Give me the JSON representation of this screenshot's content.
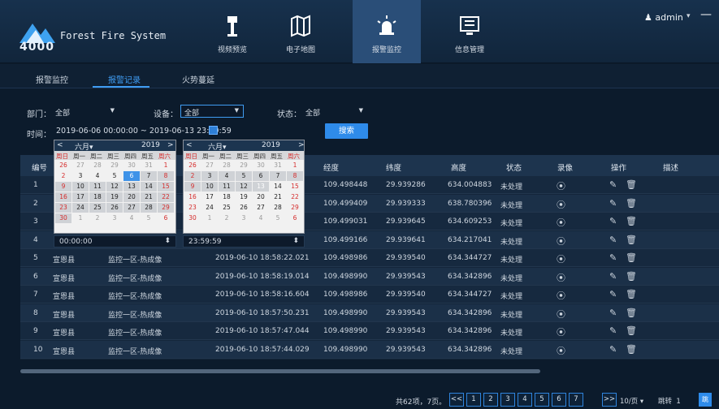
{
  "app": {
    "logo_number": "4000",
    "title": "Forest Fire System"
  },
  "nav": [
    {
      "label": "视频预览",
      "icon": "camera-tower-icon"
    },
    {
      "label": "电子地图",
      "icon": "map-icon"
    },
    {
      "label": "报警监控",
      "icon": "alarm-icon"
    },
    {
      "label": "信息管理",
      "icon": "monitor-info-icon"
    }
  ],
  "user": {
    "name": "admin",
    "dropdown": "▾",
    "minimize": "—",
    "close": "×"
  },
  "tabs": [
    "报警监控",
    "报警记录",
    "火势蔓延"
  ],
  "filters": {
    "dept_label": "部门：",
    "dept_value": "全部",
    "device_label": "设备：",
    "device_value": "全部",
    "status_label": "状态：",
    "status_value": "全部",
    "time_label": "时间：",
    "time_value": "2019-06-06 00:00:00 ~ 2019-06-13 23:59:59",
    "search_label": "搜索"
  },
  "calendar": {
    "left": {
      "prev": "<",
      "month": "六月▾",
      "year": "2019",
      "next": ">",
      "time": "00:00:00",
      "spin": "⬍"
    },
    "right": {
      "prev": "<",
      "month": "六月▾",
      "year": "2019",
      "next": ">",
      "time": "23:59:59",
      "spin": "⬍"
    },
    "weekdays": [
      "周日",
      "周一",
      "周二",
      "周三",
      "周四",
      "周五",
      "周六"
    ],
    "left_days": [
      [
        "26",
        "27",
        "28",
        "29",
        "30",
        "31",
        "1"
      ],
      [
        "2",
        "3",
        "4",
        "5",
        "6",
        "7",
        "8"
      ],
      [
        "9",
        "10",
        "11",
        "12",
        "13",
        "14",
        "15"
      ],
      [
        "16",
        "17",
        "18",
        "19",
        "20",
        "21",
        "22"
      ],
      [
        "23",
        "24",
        "25",
        "26",
        "27",
        "28",
        "29"
      ],
      [
        "30",
        "1",
        "2",
        "3",
        "4",
        "5",
        "6"
      ]
    ],
    "right_days": [
      [
        "26",
        "27",
        "28",
        "29",
        "30",
        "31",
        "1"
      ],
      [
        "2",
        "3",
        "4",
        "5",
        "6",
        "7",
        "8"
      ],
      [
        "9",
        "10",
        "11",
        "12",
        "13",
        "14",
        "15"
      ],
      [
        "16",
        "17",
        "18",
        "19",
        "20",
        "21",
        "22"
      ],
      [
        "23",
        "24",
        "25",
        "26",
        "27",
        "28",
        "29"
      ],
      [
        "30",
        "1",
        "2",
        "3",
        "4",
        "5",
        "6"
      ]
    ]
  },
  "table": {
    "headers": [
      "编号",
      "经度",
      "纬度",
      "高度",
      "状态",
      "录像",
      "操作",
      "描述"
    ],
    "rows": [
      {
        "no": "1",
        "county": "",
        "device": "",
        "time": "",
        "lng": "109.498448",
        "lat": "29.939286",
        "alt": "634.004883",
        "status": "未处理"
      },
      {
        "no": "2",
        "county": "",
        "device": "",
        "time": "",
        "lng": "109.499409",
        "lat": "29.939333",
        "alt": "638.780396",
        "status": "未处理"
      },
      {
        "no": "3",
        "county": "",
        "device": "",
        "time": "",
        "lng": "109.499031",
        "lat": "29.939645",
        "alt": "634.609253",
        "status": "未处理"
      },
      {
        "no": "4",
        "county": "",
        "device": "",
        "time": "",
        "lng": "109.499166",
        "lat": "29.939641",
        "alt": "634.217041",
        "status": "未处理"
      },
      {
        "no": "5",
        "county": "宣恩县",
        "device": "监控一区-热成像",
        "time": "2019-06-10 18:58:22.021",
        "lng": "109.498986",
        "lat": "29.939540",
        "alt": "634.344727",
        "status": "未处理"
      },
      {
        "no": "6",
        "county": "宣恩县",
        "device": "监控一区-热成像",
        "time": "2019-06-10 18:58:19.014",
        "lng": "109.498990",
        "lat": "29.939543",
        "alt": "634.342896",
        "status": "未处理"
      },
      {
        "no": "7",
        "county": "宣恩县",
        "device": "监控一区-热成像",
        "time": "2019-06-10 18:58:16.604",
        "lng": "109.498986",
        "lat": "29.939540",
        "alt": "634.344727",
        "status": "未处理"
      },
      {
        "no": "8",
        "county": "宣恩县",
        "device": "监控一区-热成像",
        "time": "2019-06-10 18:57:50.231",
        "lng": "109.498990",
        "lat": "29.939543",
        "alt": "634.342896",
        "status": "未处理"
      },
      {
        "no": "9",
        "county": "宣恩县",
        "device": "监控一区-热成像",
        "time": "2019-06-10 18:57:47.044",
        "lng": "109.498990",
        "lat": "29.939543",
        "alt": "634.342896",
        "status": "未处理"
      },
      {
        "no": "10",
        "county": "宣恩县",
        "device": "监控一区-热成像",
        "time": "2019-06-10 18:57:44.029",
        "lng": "109.498990",
        "lat": "29.939543",
        "alt": "634.342896",
        "status": "未处理"
      }
    ]
  },
  "pager": {
    "summary": "共62项，7页。",
    "first": "<<",
    "last": ">>",
    "pages": [
      "1",
      "2",
      "3",
      "4",
      "5",
      "6",
      "7"
    ],
    "page_size": "10/页",
    "page_size_arrow": "▾",
    "jump_label": "跳转",
    "jump_value": "1",
    "go_label": "跳"
  },
  "colors": {
    "accent": "#3f9cf2",
    "header_bg": "#17314d",
    "table_bg": "#16293f"
  }
}
